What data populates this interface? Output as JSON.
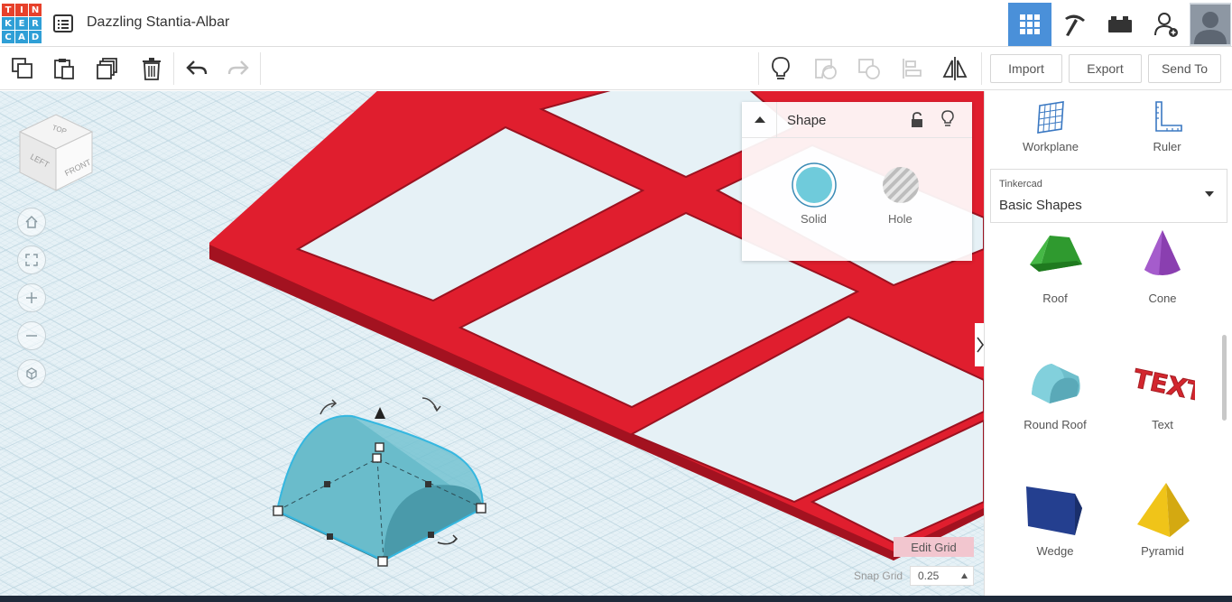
{
  "app": {
    "logo_letters": [
      "T",
      "I",
      "N",
      "K",
      "E",
      "R",
      "C",
      "A",
      "D"
    ],
    "logo_colors": [
      "#e7412b",
      "#e7412b",
      "#e7412b",
      "#2f9fd6",
      "#2f9fd6",
      "#2f9fd6",
      "#2f9fd6",
      "#2f9fd6",
      "#2f9fd6"
    ],
    "doc_title": "Dazzling Stantia-Albar"
  },
  "top_nav": {
    "items": [
      "3d-design-view",
      "build-pickaxe",
      "bricks",
      "invite-user",
      "profile-avatar"
    ],
    "active": "3d-design-view",
    "active_color": "#4a90d9"
  },
  "toolbar": {
    "import_label": "Import",
    "export_label": "Export",
    "send_to_label": "Send To"
  },
  "view_cube": {
    "top": "TOP",
    "left": "LEFT",
    "front": "FRONT"
  },
  "shape_panel": {
    "title": "Shape",
    "solid_label": "Solid",
    "hole_label": "Hole",
    "solid_color": "#6fcbdb"
  },
  "grid": {
    "edit_grid_label": "Edit Grid",
    "snap_label": "Snap Grid",
    "snap_value": "0.25"
  },
  "sidebar": {
    "workplane_label": "Workplane",
    "ruler_label": "Ruler",
    "library_provider": "Tinkercad",
    "library_name": "Basic Shapes",
    "shapes": [
      {
        "label": "Roof",
        "color": "#3aa83a"
      },
      {
        "label": "Cone",
        "color": "#8a3fb0"
      },
      {
        "label": "Round Roof",
        "color": "#6fbfcc"
      },
      {
        "label": "Text",
        "color": "#d3262e"
      },
      {
        "label": "Wedge",
        "color": "#1f3a8a"
      },
      {
        "label": "Pyramid",
        "color": "#f0c419"
      }
    ]
  },
  "scene": {
    "model_color": "#e01e2e",
    "selected_color": "#5fb6c6"
  }
}
